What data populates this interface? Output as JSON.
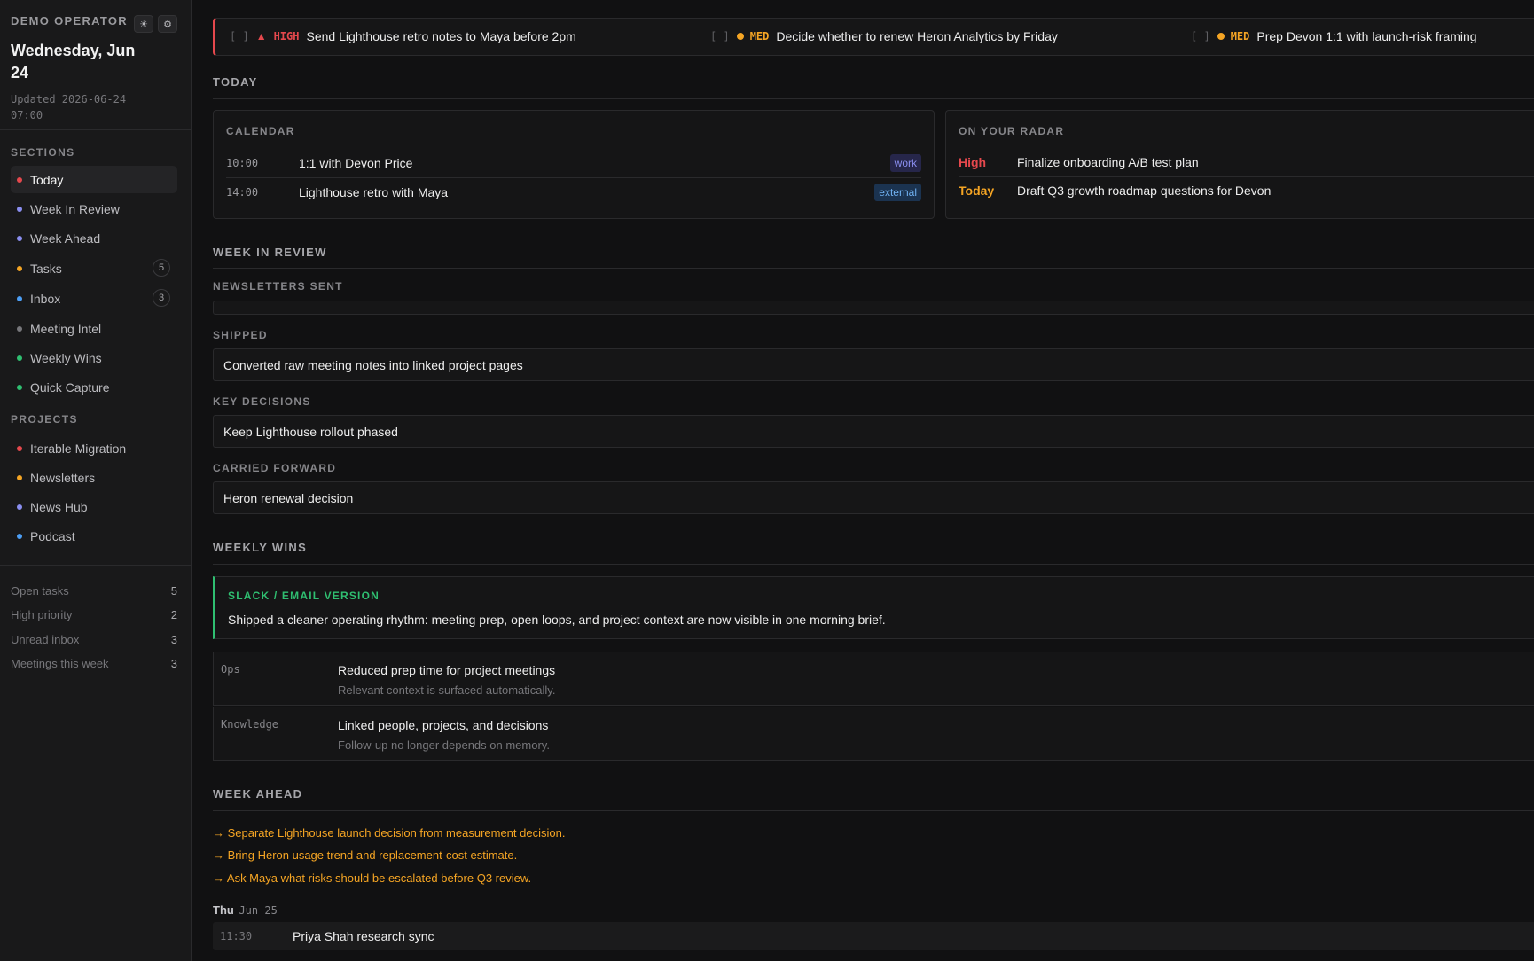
{
  "sidebar": {
    "operator": "DEMO OPERATOR",
    "theme_icon": "sun-icon",
    "settings_icon": "gear-icon",
    "date": "Wednesday, Jun 24",
    "updated": "Updated 2026-06-24 07:00",
    "sections_label": "SECTIONS",
    "sections": [
      {
        "label": "Today",
        "color": "#e5484d",
        "count": ""
      },
      {
        "label": "Week In Review",
        "color": "#8a8ef0",
        "count": ""
      },
      {
        "label": "Week Ahead",
        "color": "#8a8ef0",
        "count": ""
      },
      {
        "label": "Tasks",
        "color": "#f5a524",
        "count": "5"
      },
      {
        "label": "Inbox",
        "color": "#4c9ef5",
        "count": "3"
      },
      {
        "label": "Meeting Intel",
        "color": "#77777b",
        "count": ""
      },
      {
        "label": "Weekly Wins",
        "color": "#2fbf71",
        "count": ""
      },
      {
        "label": "Quick Capture",
        "color": "#2fbf71",
        "count": ""
      }
    ],
    "projects_label": "PROJECTS",
    "projects": [
      {
        "label": "Iterable Migration",
        "color": "#e5484d"
      },
      {
        "label": "Newsletters",
        "color": "#f5a524"
      },
      {
        "label": "News Hub",
        "color": "#8a8ef0"
      },
      {
        "label": "Podcast",
        "color": "#4c9ef5"
      }
    ],
    "stats": [
      {
        "label": "Open tasks",
        "value": "5"
      },
      {
        "label": "High priority",
        "value": "2"
      },
      {
        "label": "Unread inbox",
        "value": "3"
      },
      {
        "label": "Meetings this week",
        "value": "3"
      }
    ]
  },
  "tasks": [
    {
      "check": "[ ]",
      "priority": "HIGH",
      "marker": "▲",
      "color": "#e5484d",
      "text": "Send Lighthouse retro notes to Maya before 2pm"
    },
    {
      "check": "[ ]",
      "priority": "MED",
      "marker": "dot",
      "color": "#f5a524",
      "text": "Decide whether to renew Heron Analytics by Friday"
    },
    {
      "check": "[ ]",
      "priority": "MED",
      "marker": "dot",
      "color": "#f5a524",
      "text": "Prep Devon 1:1 with launch-risk framing"
    }
  ],
  "today": {
    "title": "TODAY",
    "calendar_label": "CALENDAR",
    "calendar": [
      {
        "time": "10:00",
        "title": "1:1 with Devon Price",
        "tag": "work"
      },
      {
        "time": "14:00",
        "title": "Lighthouse retro with Maya",
        "tag": "external"
      }
    ],
    "radar_label": "ON YOUR RADAR",
    "radar": [
      {
        "key": "High",
        "color": "#e5484d",
        "text": "Finalize onboarding A/B test plan"
      },
      {
        "key": "Today",
        "color": "#f5a524",
        "text": "Draft Q3 growth roadmap questions for Devon"
      }
    ]
  },
  "week_in_review": {
    "title": "WEEK IN REVIEW",
    "newsletters_label": "NEWSLETTERS SENT",
    "shipped_label": "SHIPPED",
    "shipped": "Converted raw meeting notes into linked project pages",
    "decisions_label": "KEY DECISIONS",
    "decisions": "Keep Lighthouse rollout phased",
    "carried_label": "CARRIED FORWARD",
    "carried": "Heron renewal decision"
  },
  "weekly_wins": {
    "title": "WEEKLY WINS",
    "callout_label": "SLACK / EMAIL VERSION",
    "callout_text": "Shipped a cleaner operating rhythm: meeting prep, open loops, and project context are now visible in one morning brief.",
    "rows": [
      {
        "category": "Ops",
        "title": "Reduced prep time for project meetings",
        "sub": "Relevant context is surfaced automatically."
      },
      {
        "category": "Knowledge",
        "title": "Linked people, projects, and decisions",
        "sub": "Follow-up no longer depends on memory."
      }
    ]
  },
  "week_ahead": {
    "title": "WEEK AHEAD",
    "items": [
      "→ Separate Lighthouse launch decision from measurement decision.",
      "→ Bring Heron usage trend and replacement-cost estimate.",
      "→ Ask Maya what risks should be escalated before Q3 review."
    ],
    "day": "Thu",
    "day_date": "Jun 25",
    "events": [
      {
        "time": "11:30",
        "title": "Priya Shah research sync"
      }
    ]
  }
}
